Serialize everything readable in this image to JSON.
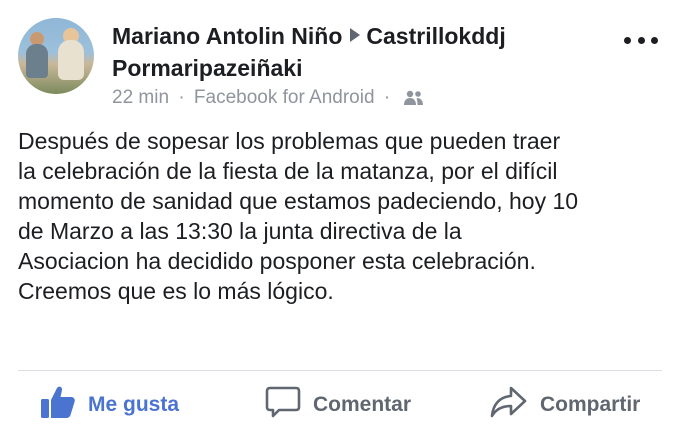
{
  "post": {
    "author": "Mariano Antolin Niño",
    "target": "Castrillokddj Pormaripazeiñaki",
    "time": "22 min",
    "separator": "·",
    "source": "Facebook for Android",
    "audience_icon": "friends-icon",
    "text": "Después de sopesar los problemas que pueden traer\nla celebración de la fiesta de la matanza, por el difícil\nmomento de sanidad que estamos padeciendo, hoy 10\nde Marzo a las 13:30 la junta directiva de la\nAsociacion ha decidido posponer esta celebración.\nCreemos que es lo más lógico."
  },
  "actions": {
    "like": "Me gusta",
    "comment": "Comentar",
    "share": "Compartir"
  },
  "colors": {
    "like_blue": "#4a74d0",
    "text_dark": "#1c1e21",
    "meta_gray": "#90949c",
    "action_gray": "#606770"
  }
}
